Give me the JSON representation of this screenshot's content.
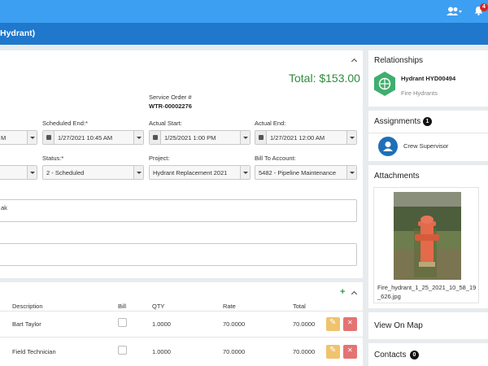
{
  "header": {
    "notification_count": "4",
    "title": "Hydrant)"
  },
  "order": {
    "total": "Total: $153.00",
    "service_order_label": "Service Order #",
    "service_order_value": "WTR-00002276",
    "scheduled_start_partial": "M",
    "scheduled_end_label": "Scheduled End:*",
    "scheduled_end_value": "1/27/2021 10:45 AM",
    "actual_start_label": "Actual Start:",
    "actual_start_value": "1/25/2021 1:00 PM",
    "actual_end_label": "Actual End:",
    "actual_end_value": "1/27/2021 12:00 AM",
    "status_label": "Status:*",
    "status_value": "2 - Scheduled",
    "project_label": "Project:",
    "project_value": "Hydrant Replacement 2021",
    "bill_to_label": "Bill To Account:",
    "bill_to_value": "5482 - Pipeline Maintenance",
    "description_partial": "ak"
  },
  "lines": {
    "columns": {
      "description": "Description",
      "bill": "Bill",
      "qty": "QTY",
      "rate": "Rate",
      "total": "Total"
    },
    "rows": [
      {
        "description": "Bart Taylor",
        "qty": "1.0000",
        "rate": "70.0000",
        "total": "70.0000"
      },
      {
        "description": "Field Technician",
        "qty": "1.0000",
        "rate": "70.0000",
        "total": "70.0000"
      }
    ]
  },
  "relationships": {
    "title": "Relationships",
    "item_name": "Hydrant HYD00494",
    "item_type": "Fire Hydrants"
  },
  "assignments": {
    "title": "Assignments",
    "count": "1",
    "item": "Crew Supervisor"
  },
  "attachments": {
    "title": "Attachments",
    "file_name_line1": "Fire_hydrant_1_25_2021_10_58_19",
    "file_name_line2": "_626.jpg"
  },
  "map": {
    "title": "View On Map"
  },
  "contacts": {
    "title": "Contacts",
    "count": "0"
  }
}
